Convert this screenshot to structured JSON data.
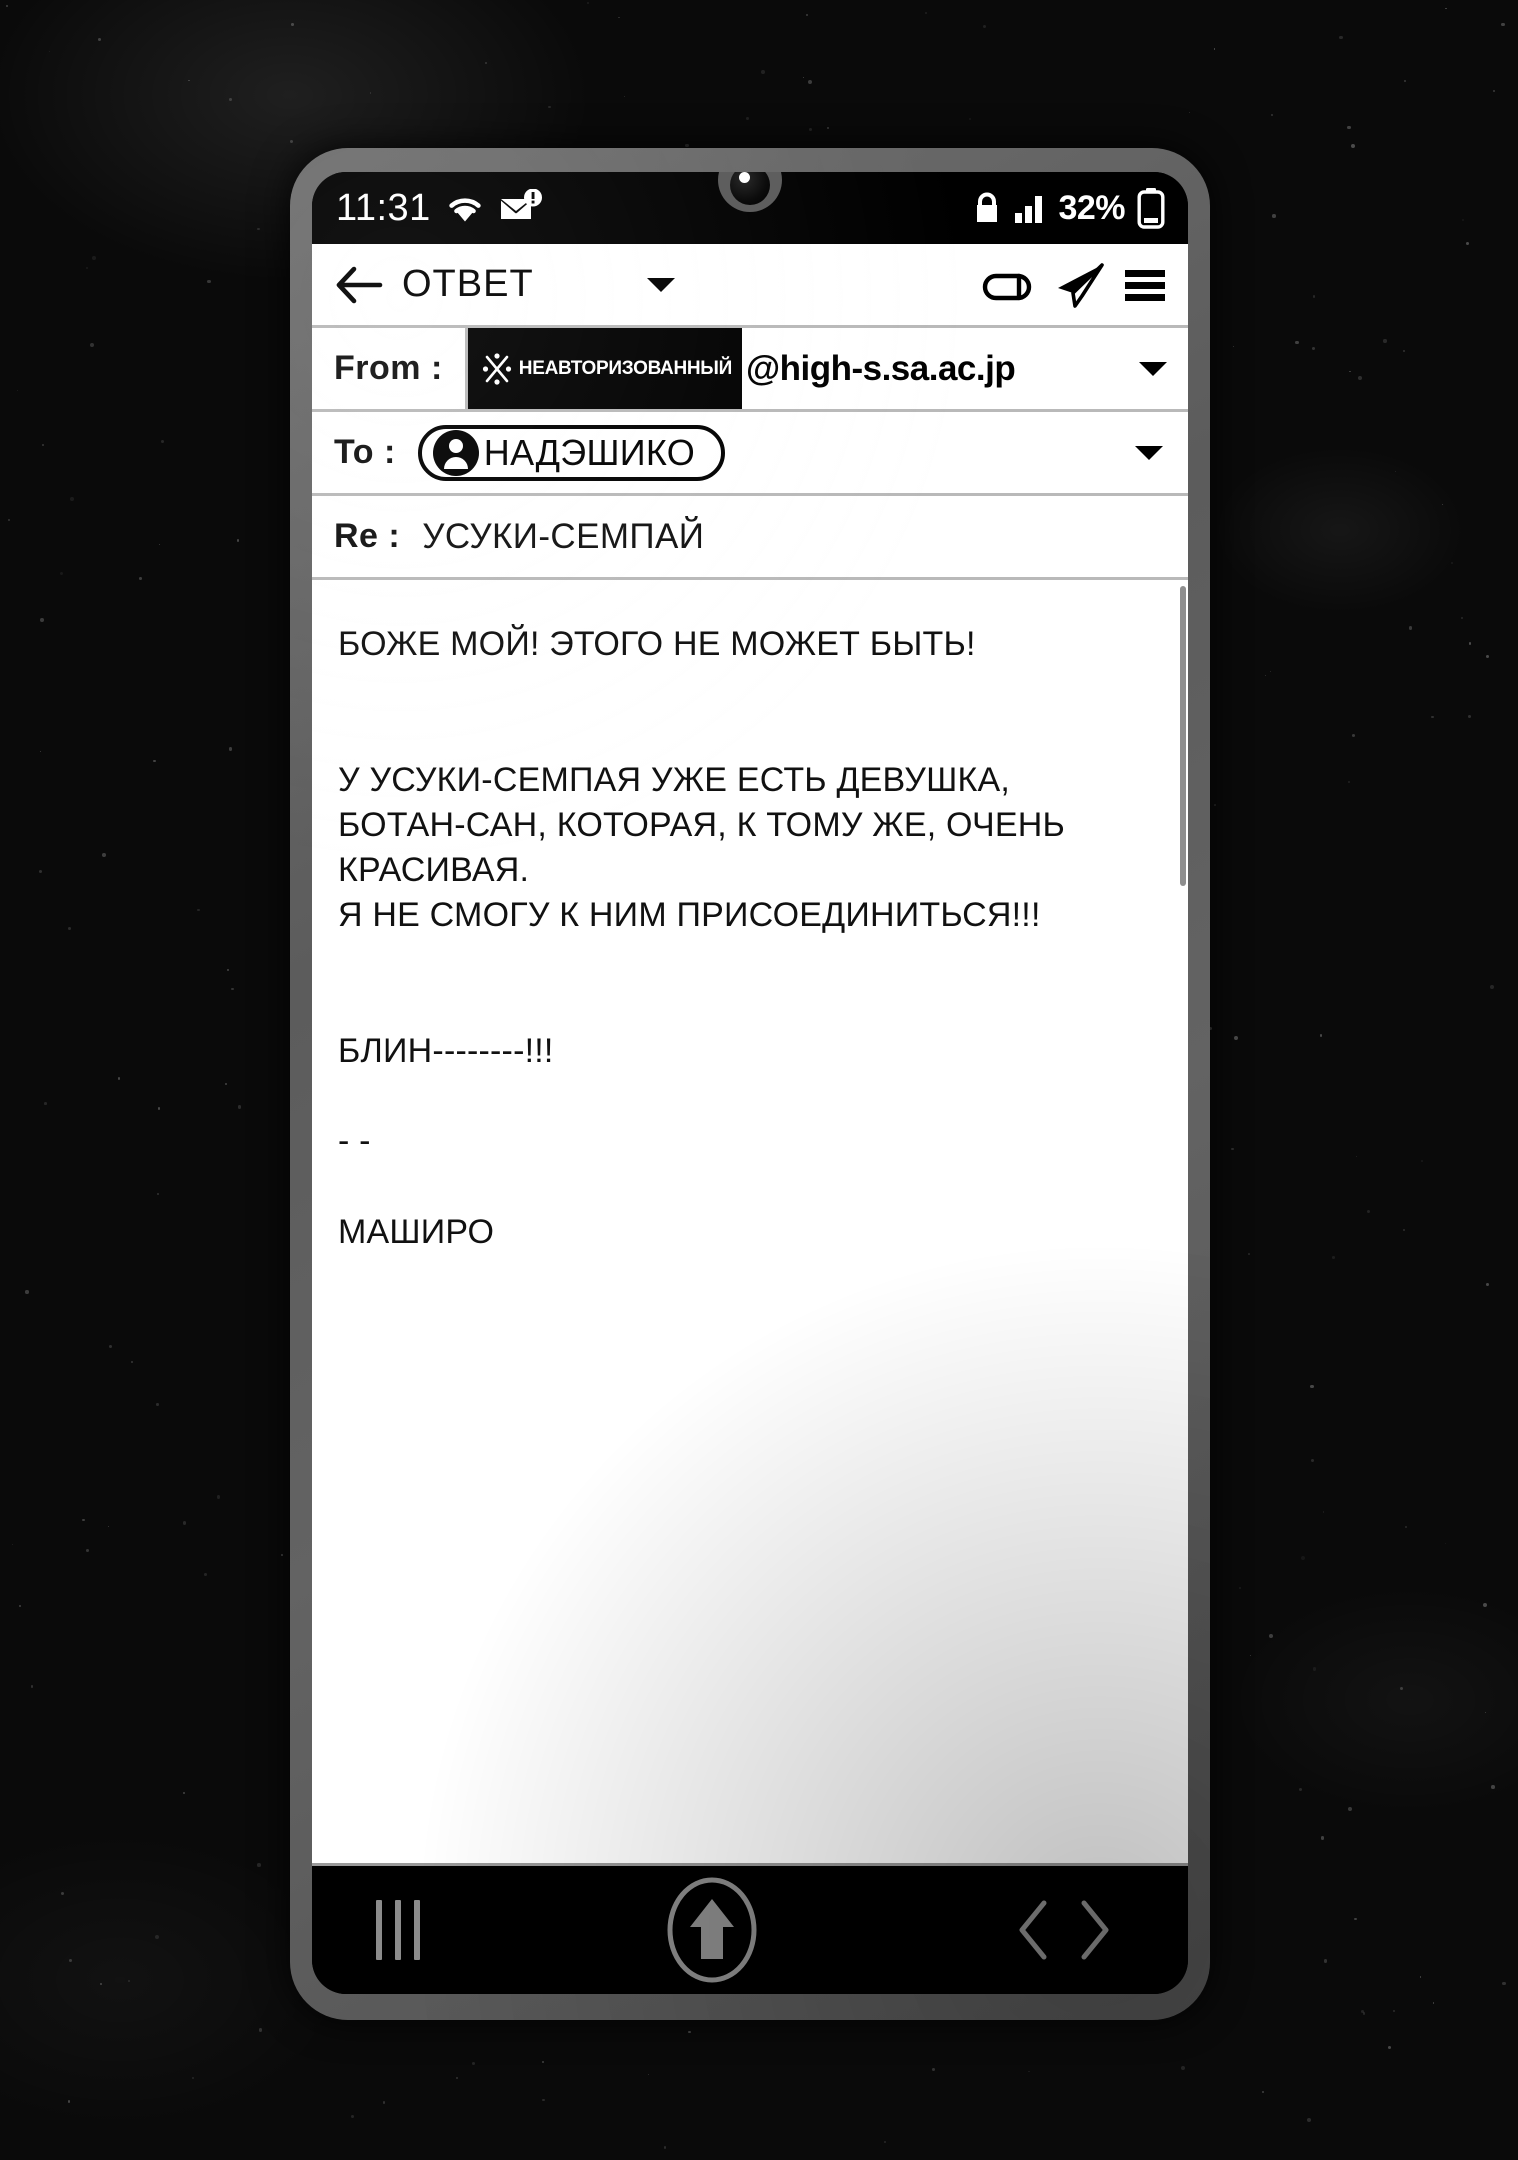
{
  "status_bar": {
    "time": "11:31",
    "wifi_icon": "wifi-icon",
    "mail_icon": "mail-alert-icon",
    "lock_icon": "lock-icon",
    "signal_icon": "signal-bars-icon",
    "battery_percent": "32%",
    "battery_icon": "battery-low-icon"
  },
  "toolbar": {
    "back_icon": "back-arrow-icon",
    "title": "ОТВЕТ",
    "dropdown_icon": "chevron-down-icon",
    "attach_icon": "attachment-icon",
    "send_icon": "send-paper-plane-icon",
    "menu_icon": "hamburger-menu-icon"
  },
  "compose": {
    "from": {
      "label": "From :",
      "badge_icon": "unauthorized-mark-icon",
      "badge_text": "НЕАВТОРИЗОВАННЫЙ",
      "domain": "@high-s.sa.ac.jp",
      "caret_icon": "chevron-down-icon"
    },
    "to": {
      "label": "To :",
      "avatar_icon": "contact-avatar-icon",
      "recipient": "НАДЭШИКО",
      "caret_icon": "chevron-down-icon"
    },
    "subject": {
      "label": "Re :",
      "value": "УСУКИ-СЕМПАЙ"
    },
    "body": "БОЖЕ МОЙ! ЭТОГО НЕ МОЖЕТ БЫТЬ!\n\n\nУ УСУКИ-СЕМПАЯ УЖЕ ЕСТЬ ДЕВУШКА,\nБОТАН-САН, КОТОРАЯ, К ТОМУ ЖЕ, ОЧЕНЬ\nКРАСИВАЯ.\nЯ НЕ СМОГУ К НИМ ПРИСОЕДИНИТЬСЯ!!!\n\n\nБЛИН--------!!!\n\n- -\n\nМАШИРО"
  },
  "nav_bar": {
    "recents_icon": "recents-bars-icon",
    "home_icon": "home-up-arrow-icon",
    "back_forward_icon": "chevron-left-right-icon"
  },
  "colors": {
    "screen_bg": "#000000",
    "panel_bg": "#ffffff",
    "text": "#111111",
    "bezel": "#5c5c5c",
    "nav_icon": "#8c8c8c",
    "divider": "#b9b9b9"
  }
}
